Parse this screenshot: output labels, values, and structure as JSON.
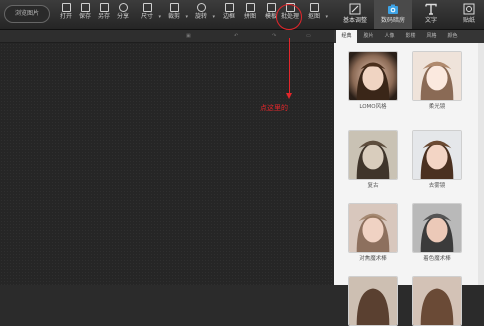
{
  "toolbar": {
    "browse_label": "浏览图片",
    "tools": [
      {
        "label": "打开",
        "icon": "folder-open-icon"
      },
      {
        "label": "保存",
        "icon": "save-icon"
      },
      {
        "label": "另存",
        "icon": "save-as-icon"
      },
      {
        "label": "分享",
        "icon": "share-icon"
      },
      {
        "label": "尺寸",
        "icon": "resize-icon"
      },
      {
        "label": "裁剪",
        "icon": "crop-icon"
      },
      {
        "label": "旋转",
        "icon": "rotate-icon"
      },
      {
        "label": "边框",
        "icon": "border-icon"
      },
      {
        "label": "拼图",
        "icon": "puzzle-icon"
      },
      {
        "label": "模板",
        "icon": "template-icon"
      },
      {
        "label": "批处理",
        "icon": "batch-icon"
      },
      {
        "label": "抠图",
        "icon": "cutout-icon"
      }
    ],
    "modes": [
      {
        "label": "基本调整",
        "icon": "basic-adjust-icon"
      },
      {
        "label": "数码暗房",
        "icon": "camera-icon"
      },
      {
        "label": "文字",
        "icon": "text-icon"
      },
      {
        "label": "贴纸",
        "icon": "sticker-icon"
      }
    ]
  },
  "subbar": {
    "items": [
      "",
      "",
      "",
      ""
    ]
  },
  "annotation": {
    "label": "点这里的",
    "color": "#e3262b"
  },
  "panel": {
    "tabs": [
      "经典",
      "胶片",
      "人像",
      "影楼",
      "风格",
      "颜色"
    ],
    "effects": [
      {
        "label": "LOMO风格"
      },
      {
        "label": "柔光镜"
      },
      {
        "label": "复古"
      },
      {
        "label": "去雾镜"
      },
      {
        "label": "对焦魔术棒"
      },
      {
        "label": "着色魔术棒"
      }
    ]
  }
}
